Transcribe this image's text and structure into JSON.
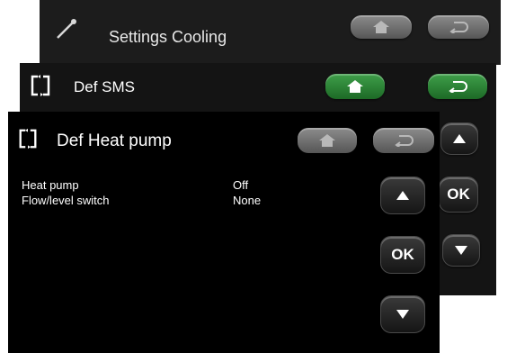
{
  "screens": {
    "cooling": {
      "title": "Settings Cooling"
    },
    "sms": {
      "title": "Def  SMS"
    },
    "heat_pump": {
      "title": "Def Heat pump",
      "rows": [
        {
          "label": "Heat pump",
          "value": "Off"
        },
        {
          "label": "Flow/level switch",
          "value": "None"
        }
      ]
    }
  },
  "buttons": {
    "ok_label": "OK"
  },
  "icons": {
    "wrench": "wrench-icon",
    "refresh": "refresh-icon",
    "home": "home-icon",
    "back": "back-icon",
    "up": "up-arrow-icon",
    "down": "down-arrow-icon"
  },
  "colors": {
    "green_button": "#2c8a37",
    "grey_button": "#7a7a7a"
  }
}
